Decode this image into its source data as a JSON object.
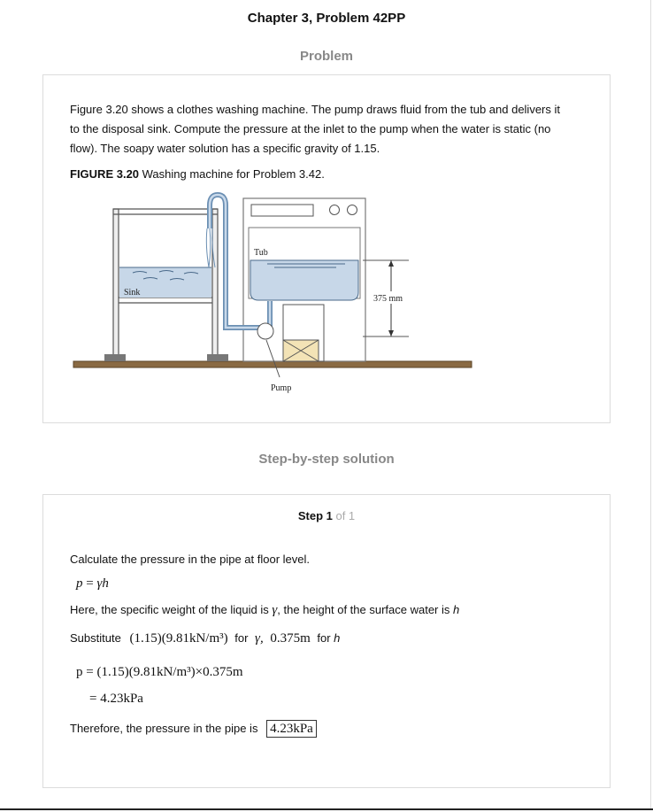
{
  "header": {
    "title": "Chapter 3, Problem 42PP"
  },
  "problem": {
    "heading": "Problem",
    "text": "Figure 3.20 shows a clothes washing machine. The pump draws fluid from the tub and delivers it to the disposal sink. Compute the pressure at the inlet to the pump when the water is static (no flow). The soapy water solution has a specific gravity of 1.15.",
    "figure_label": "FIGURE 3.20",
    "figure_caption": " Washing machine for Problem 3.42.",
    "figure": {
      "tub_label": "Tub",
      "sink_label": "Sink",
      "pump_label": "Pump",
      "height_label": "375 mm"
    }
  },
  "solution": {
    "heading": "Step-by-step solution",
    "step_label": "Step 1",
    "step_of": " of 1",
    "line1": "Calculate the pressure in the pipe at floor level.",
    "eq1_lhs": "p",
    "eq1_eq": " = ",
    "eq1_gamma": "γ",
    "eq1_h": "h",
    "here_text": "Here, the specific weight of the liquid is",
    "here_gamma": "γ",
    "here_mid": ", the height of the surface water is",
    "here_h": "h",
    "subst_label": "Substitute",
    "subst_value1": "(1.15)(9.81kN/m³)",
    "subst_for1": "for",
    "subst_gamma": "γ,",
    "subst_value2": "0.375m",
    "subst_for2": "for",
    "subst_h": "h",
    "calc_line1": "p = (1.15)(9.81kN/m³)×0.375m",
    "calc_line2": "= 4.23kPa",
    "therefore_text": "Therefore, the pressure in the pipe is",
    "answer": "4.23kPa"
  }
}
